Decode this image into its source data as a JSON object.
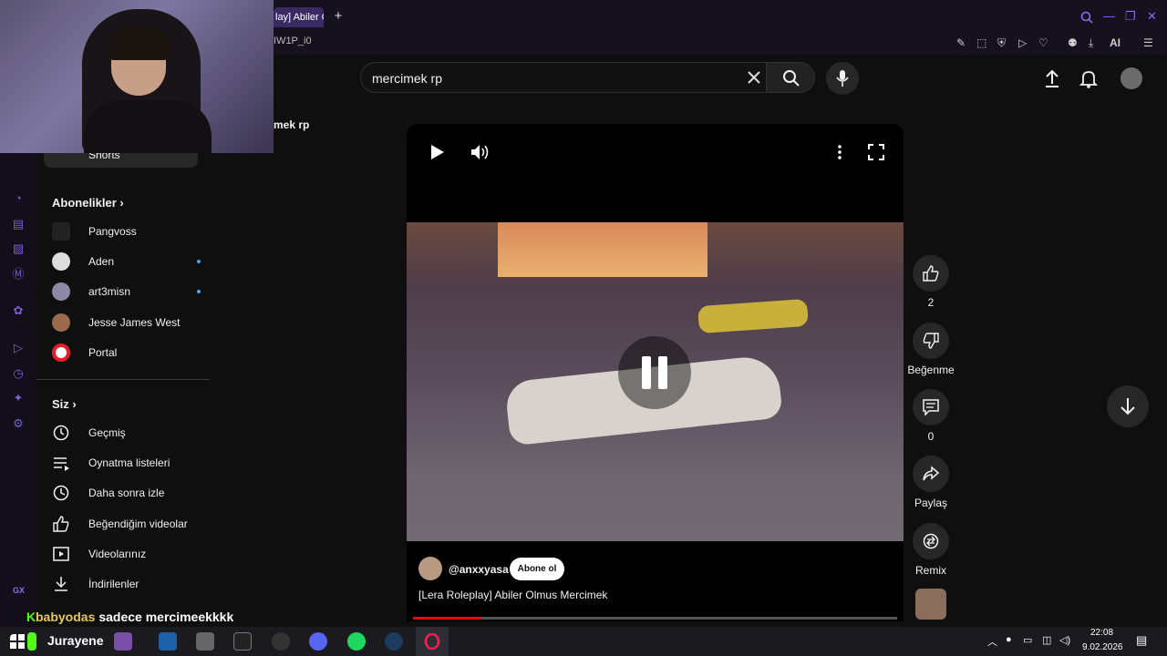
{
  "browser": {
    "tab_title": "lay] Abiler O",
    "address_fragment": "IW1P_i0",
    "ai_label": "AI",
    "gx_label": "GX"
  },
  "search": {
    "query": "mercimek rp"
  },
  "partial_text": "mek rp",
  "sidebar": {
    "shorts_label": "Shorts",
    "subscriptions_heading": "Abonelikler",
    "subscriptions": [
      {
        "name": "Pangvoss",
        "new": false
      },
      {
        "name": "Aden",
        "new": true
      },
      {
        "name": "art3misn",
        "new": true
      },
      {
        "name": "Jesse James West",
        "new": false
      },
      {
        "name": "Portal",
        "new": false
      }
    ],
    "you_heading": "Siz",
    "you_items": [
      {
        "label": "Geçmiş",
        "icon": "history-icon"
      },
      {
        "label": "Oynatma listeleri",
        "icon": "playlist-icon"
      },
      {
        "label": "Daha sonra izle",
        "icon": "clock-icon"
      },
      {
        "label": "Beğendiğim videolar",
        "icon": "thumbs-up-icon"
      },
      {
        "label": "Videolarınız",
        "icon": "video-icon"
      },
      {
        "label": "İndirilenler",
        "icon": "download-icon"
      }
    ]
  },
  "player": {
    "channel": "@anxxyasa",
    "subscribe_label": "Abone ol",
    "title": "[Lera Roleplay] Abiler Olmus Mercimek",
    "progress_percent": 14
  },
  "actions": {
    "like_count": "2",
    "dislike_label": "Beğenme",
    "comment_count": "0",
    "share_label": "Paylaş",
    "remix_label": "Remix"
  },
  "chat": {
    "username": "babyodas",
    "message": "sadece mercimeekkkk"
  },
  "taskbar": {
    "overlay_text": "Jurayene",
    "time": "22:08",
    "date": "9.02.2026"
  },
  "colors": {
    "accent": "#7b5cd6",
    "brand_red": "#ff0000",
    "subscribe_dot": "#3ea6ff",
    "kick_green": "#53fc18"
  }
}
